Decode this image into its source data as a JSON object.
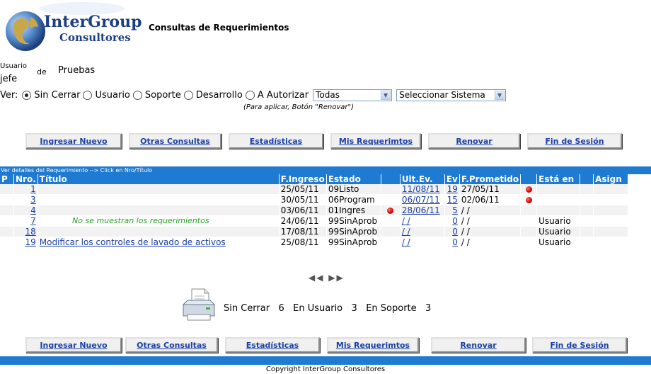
{
  "header": {
    "logo_line1": "InterGroup",
    "logo_line2": "Consultores",
    "app_title": "Consultas de Requerimientos"
  },
  "user": {
    "label": "Usuario",
    "id": "jefe",
    "de": "de",
    "name": "Pruebas"
  },
  "filters": {
    "ver_label": "Ver:",
    "options": [
      {
        "label": "Sin Cerrar",
        "selected": true
      },
      {
        "label": "Usuario",
        "selected": false
      },
      {
        "label": "Soporte",
        "selected": false
      },
      {
        "label": "Desarrollo",
        "selected": false
      },
      {
        "label": "A Autorizar",
        "selected": false
      }
    ],
    "select_todas": "Todas",
    "select_sistema": "Seleccionar Sistema",
    "hint": "(Para aplicar, Botón \"Renovar\")"
  },
  "buttons": {
    "ingresar": "Ingresar Nuevo",
    "otras": "Otras Consultas",
    "estadisticas": "Estadísticas",
    "mis": "Mis Requerimtos",
    "renovar": "Renovar",
    "fin": "Fin de Sesión"
  },
  "table": {
    "caption": "Ver detalles del Requerimiento --> Click en Nro/Título",
    "headers": {
      "p": "P",
      "nro": "Nro.",
      "titulo": "Título",
      "fingreso": "F.Ingreso",
      "estado": "Estado",
      "ultev": "Ult.Ev.",
      "ev": "Ev",
      "fprometido": "F.Prometido",
      "esta_en": "Está en",
      "asign": "Asign"
    },
    "notice": "No se muestran los requerimientos",
    "rows": [
      {
        "nro": "1",
        "titulo": "",
        "fingreso": "25/05/11",
        "estado": "09Listo",
        "alert1": false,
        "ultev": "11/08/11",
        "ev": "19",
        "fprometido": "27/05/11",
        "alert2": true,
        "esta_en": "",
        "asign": ""
      },
      {
        "nro": "3",
        "titulo": "",
        "fingreso": "30/05/11",
        "estado": "06Program",
        "alert1": false,
        "ultev": "06/07/11",
        "ev": "15",
        "fprometido": "02/06/11",
        "alert2": true,
        "esta_en": "",
        "asign": ""
      },
      {
        "nro": "4",
        "titulo": "",
        "fingreso": "03/06/11",
        "estado": "01Ingres",
        "alert1": true,
        "ultev": "28/06/11",
        "ev": "5",
        "fprometido": "/ /",
        "alert2": false,
        "esta_en": "",
        "asign": ""
      },
      {
        "nro": "7",
        "titulo": "",
        "fingreso": "24/06/11",
        "estado": "99SinAprob",
        "alert1": false,
        "ultev": "/ /",
        "ev": "0",
        "fprometido": "/ /",
        "alert2": false,
        "esta_en": "Usuario",
        "asign": ""
      },
      {
        "nro": "18",
        "titulo": "",
        "fingreso": "17/08/11",
        "estado": "99SinAprob",
        "alert1": false,
        "ultev": "/ /",
        "ev": "0",
        "fprometido": "/ /",
        "alert2": false,
        "esta_en": "Usuario",
        "asign": ""
      },
      {
        "nro": "19",
        "titulo": "Modificar los controles de lavado de activos",
        "fingreso": "25/08/11",
        "estado": "99SinAprob",
        "alert1": false,
        "ultev": "/ /",
        "ev": "0",
        "fprometido": "/ /",
        "alert2": false,
        "esta_en": "Usuario",
        "asign": ""
      }
    ]
  },
  "pager": {
    "prev": "◀◀",
    "next": "▶▶"
  },
  "summary": {
    "text": "Sin Cerrar   6   En Usuario   3   En Soporte   3"
  },
  "footer": {
    "copyright": "Copyright InterGroup Consultores"
  },
  "colors": {
    "band": "#1f7ad1",
    "link": "#1a3fa8",
    "notice": "#2aa22a",
    "alert": "#d00000"
  }
}
